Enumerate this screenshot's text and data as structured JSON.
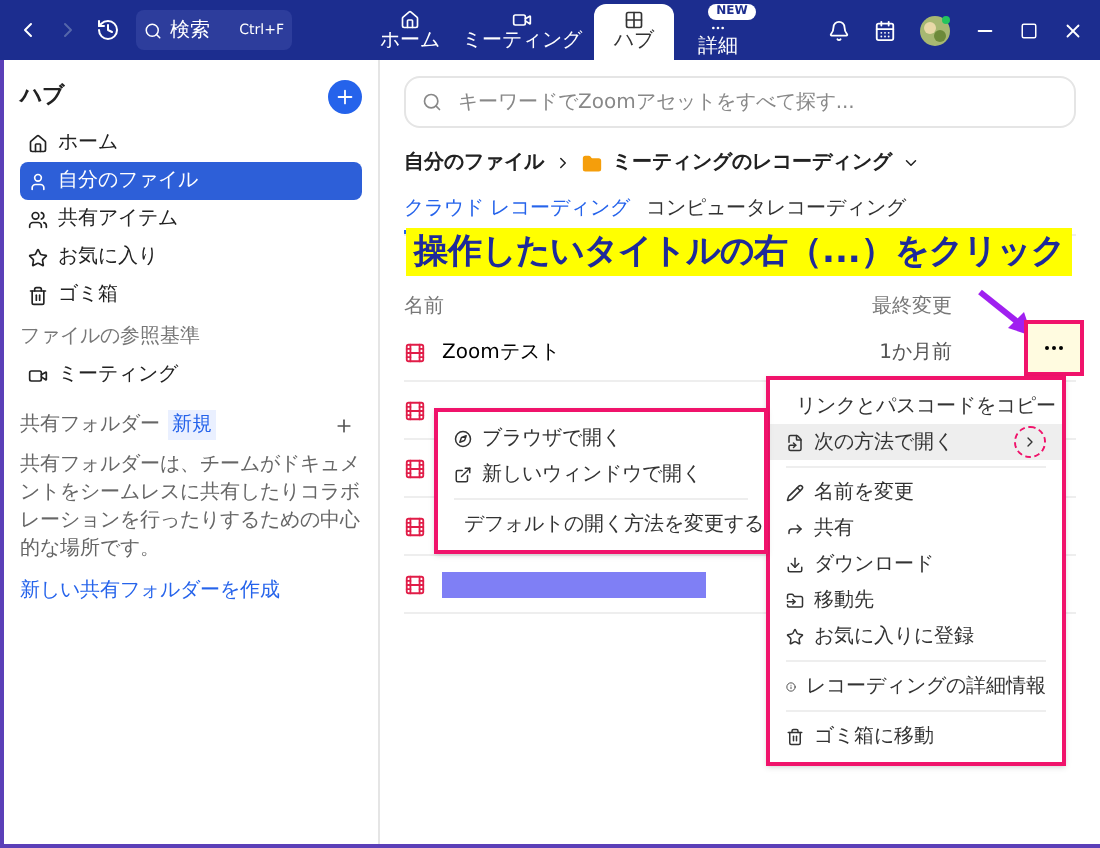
{
  "top_bar": {
    "search": {
      "placeholder": "検索",
      "shortcut": "Ctrl+F"
    },
    "tabs": [
      {
        "label": "ホーム",
        "selected": false
      },
      {
        "label": "ミーティング",
        "selected": false
      },
      {
        "label": "ハブ",
        "selected": true
      },
      {
        "label": "詳細",
        "selected": false,
        "badge": "NEW"
      }
    ]
  },
  "sidebar": {
    "title": "ハブ",
    "items": [
      {
        "label": "ホーム",
        "selected": false
      },
      {
        "label": "自分のファイル",
        "selected": true
      },
      {
        "label": "共有アイテム",
        "selected": false
      },
      {
        "label": "お気に入り",
        "selected": false
      },
      {
        "label": "ゴミ箱",
        "selected": false
      }
    ],
    "browse_heading": "ファイルの参照基準",
    "browse_items": [
      {
        "label": "ミーティング",
        "selected": false
      }
    ],
    "shared_heading": "共有フォルダー",
    "shared_badge": "新規",
    "shared_description": "共有フォルダーは、チームがドキュメントをシームレスに共有したりコラボレーションを行ったりするための中心的な場所です。",
    "create_link": "新しい共有フォルダーを作成"
  },
  "main": {
    "search": {
      "placeholder": "キーワードでZoomアセットをすべて探す..."
    },
    "breadcrumb": [
      "自分のファイル",
      "ミーティングのレコーディング"
    ],
    "tabs": [
      {
        "label": "クラウド レコーディング",
        "selected": true
      },
      {
        "label": "コンピュータレコーディング",
        "selected": false
      }
    ],
    "columns": [
      "名前",
      "最終変更"
    ],
    "rows": [
      {
        "kind": "file",
        "name": "Zoomテスト",
        "modified": "1か月前"
      },
      {
        "kind": "file"
      },
      {
        "kind": "file"
      },
      {
        "kind": "file"
      },
      {
        "kind": "file",
        "redacted": true
      }
    ],
    "callout": "操作したいタイトルの右（...）をクリック",
    "menu": [
      {
        "kind": "item",
        "label": "リンクとパスコードをコピー",
        "selected": false
      },
      {
        "kind": "item",
        "label": "次の方法で開く",
        "selected": true,
        "submenu": true
      },
      {
        "kind": "divider"
      },
      {
        "kind": "item",
        "label": "名前を変更",
        "selected": false
      },
      {
        "kind": "item",
        "label": "共有",
        "selected": false
      },
      {
        "kind": "item",
        "label": "ダウンロード",
        "selected": false
      },
      {
        "kind": "item",
        "label": "移動先",
        "selected": false
      },
      {
        "kind": "item",
        "label": "お気に入りに登録",
        "selected": false
      },
      {
        "kind": "divider"
      },
      {
        "kind": "item",
        "label": "レコーディングの詳細情報",
        "selected": false
      },
      {
        "kind": "divider"
      },
      {
        "kind": "item",
        "label": "ゴミ箱に移動",
        "selected": false
      }
    ],
    "submenu": [
      {
        "kind": "item",
        "label": "ブラウザで開く"
      },
      {
        "kind": "item",
        "label": "新しいウィンドウで開く"
      },
      {
        "kind": "divider"
      },
      {
        "kind": "item",
        "label": "デフォルトの開く方法を変更する"
      }
    ]
  }
}
